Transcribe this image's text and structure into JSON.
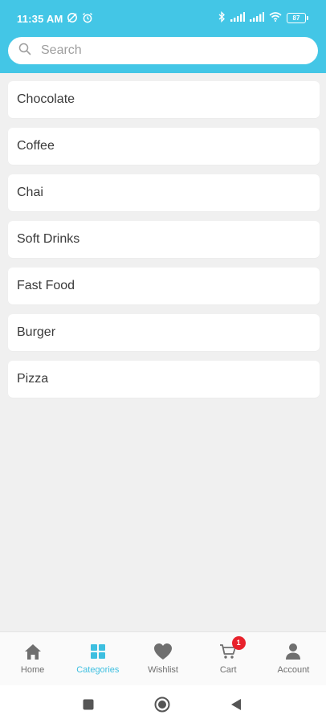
{
  "status_bar": {
    "time": "11:35 AM",
    "battery": "87"
  },
  "search": {
    "placeholder": "Search",
    "value": ""
  },
  "categories": [
    {
      "label": "Chocolate"
    },
    {
      "label": "Coffee"
    },
    {
      "label": "Chai"
    },
    {
      "label": "Soft Drinks"
    },
    {
      "label": "Fast Food"
    },
    {
      "label": "Burger"
    },
    {
      "label": "Pizza"
    }
  ],
  "bottom_nav": {
    "active": "Categories",
    "items": [
      {
        "label": "Home",
        "icon": "home-icon"
      },
      {
        "label": "Categories",
        "icon": "grid-icon"
      },
      {
        "label": "Wishlist",
        "icon": "heart-icon"
      },
      {
        "label": "Cart",
        "icon": "cart-icon",
        "badge": "1"
      },
      {
        "label": "Account",
        "icon": "person-icon"
      }
    ]
  },
  "colors": {
    "header": "#43c6e6",
    "active_tab": "#3dbfe0",
    "inactive_tab": "#6f6f6f",
    "badge": "#e8222c",
    "background": "#f0f0f0"
  }
}
